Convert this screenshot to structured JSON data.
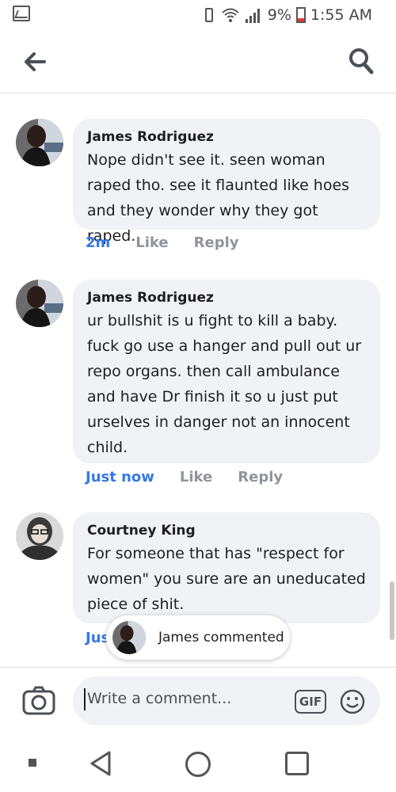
{
  "status_bar": {
    "battery": "9%",
    "time": "1:55 AM"
  },
  "app_bar": {
    "back_icon": "arrow-left-icon",
    "search_icon": "search-icon"
  },
  "comments": [
    {
      "author": "James Rodriguez",
      "text": "Nope didn't see it. seen woman raped tho. see it flaunted like hoes and they wonder why they got raped.",
      "time": "2m",
      "like_label": "Like",
      "reply_label": "Reply"
    },
    {
      "author": "James Rodriguez",
      "text": "ur bullshit is u fight to kill a baby. fuck go use a hanger and pull out ur repo organs. then call ambulance and have Dr finish it so u just put urselves in danger not an innocent child.",
      "time": "Just now",
      "like_label": "Like",
      "reply_label": "Reply"
    },
    {
      "author": "Courtney King",
      "text": "For someone that has \"respect for women\" you sure are an uneducated piece of shit.",
      "time": "Jus",
      "like_label": "",
      "reply_label": ""
    }
  ],
  "toast": {
    "text": "James commented"
  },
  "composer": {
    "placeholder": "Write a comment...",
    "gif_label": "GIF"
  },
  "colors": {
    "accent": "#3578e5",
    "bubble": "#f0f2f5",
    "muted": "#90949c"
  }
}
